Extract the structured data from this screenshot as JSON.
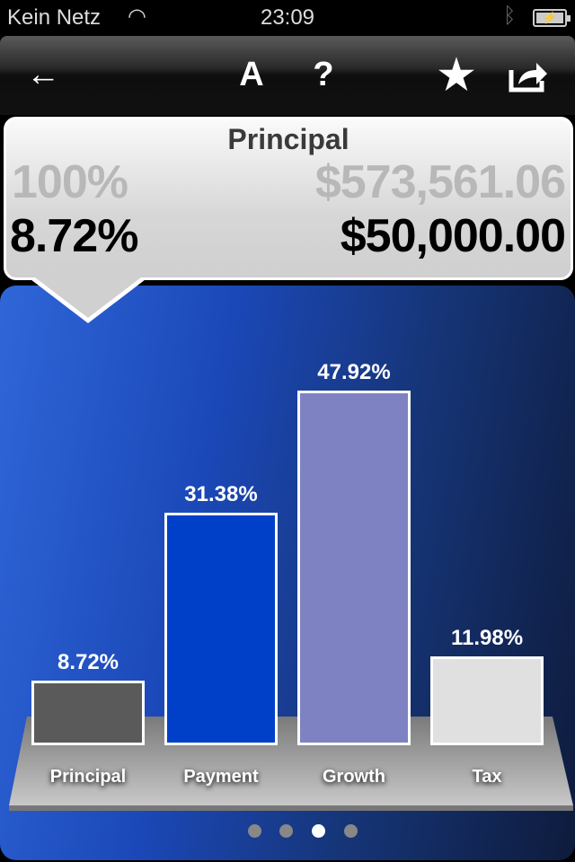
{
  "status_bar": {
    "carrier": "Kein Netz",
    "time": "23:09"
  },
  "toolbar": {
    "back_icon": "←",
    "font_label": "A",
    "help_label": "?",
    "favorite_icon": "★",
    "share_icon": "share"
  },
  "summary": {
    "title": "Principal",
    "total_percent": "100%",
    "total_amount": "$573,561.06",
    "percent": "8.72%",
    "amount": "$50,000.00"
  },
  "chart_data": {
    "type": "bar",
    "categories": [
      "Principal",
      "Payment",
      "Growth",
      "Tax"
    ],
    "values": [
      8.72,
      31.38,
      47.92,
      11.98
    ],
    "value_labels": [
      "8.72%",
      "31.38%",
      "47.92%",
      "11.98%"
    ],
    "colors": [
      "#5a5a5a",
      "#0040c8",
      "#7f82c2",
      "#e0e0e0"
    ],
    "ylim": [
      0,
      50
    ],
    "grid": false
  },
  "pager": {
    "pages": 4,
    "current": 3
  }
}
